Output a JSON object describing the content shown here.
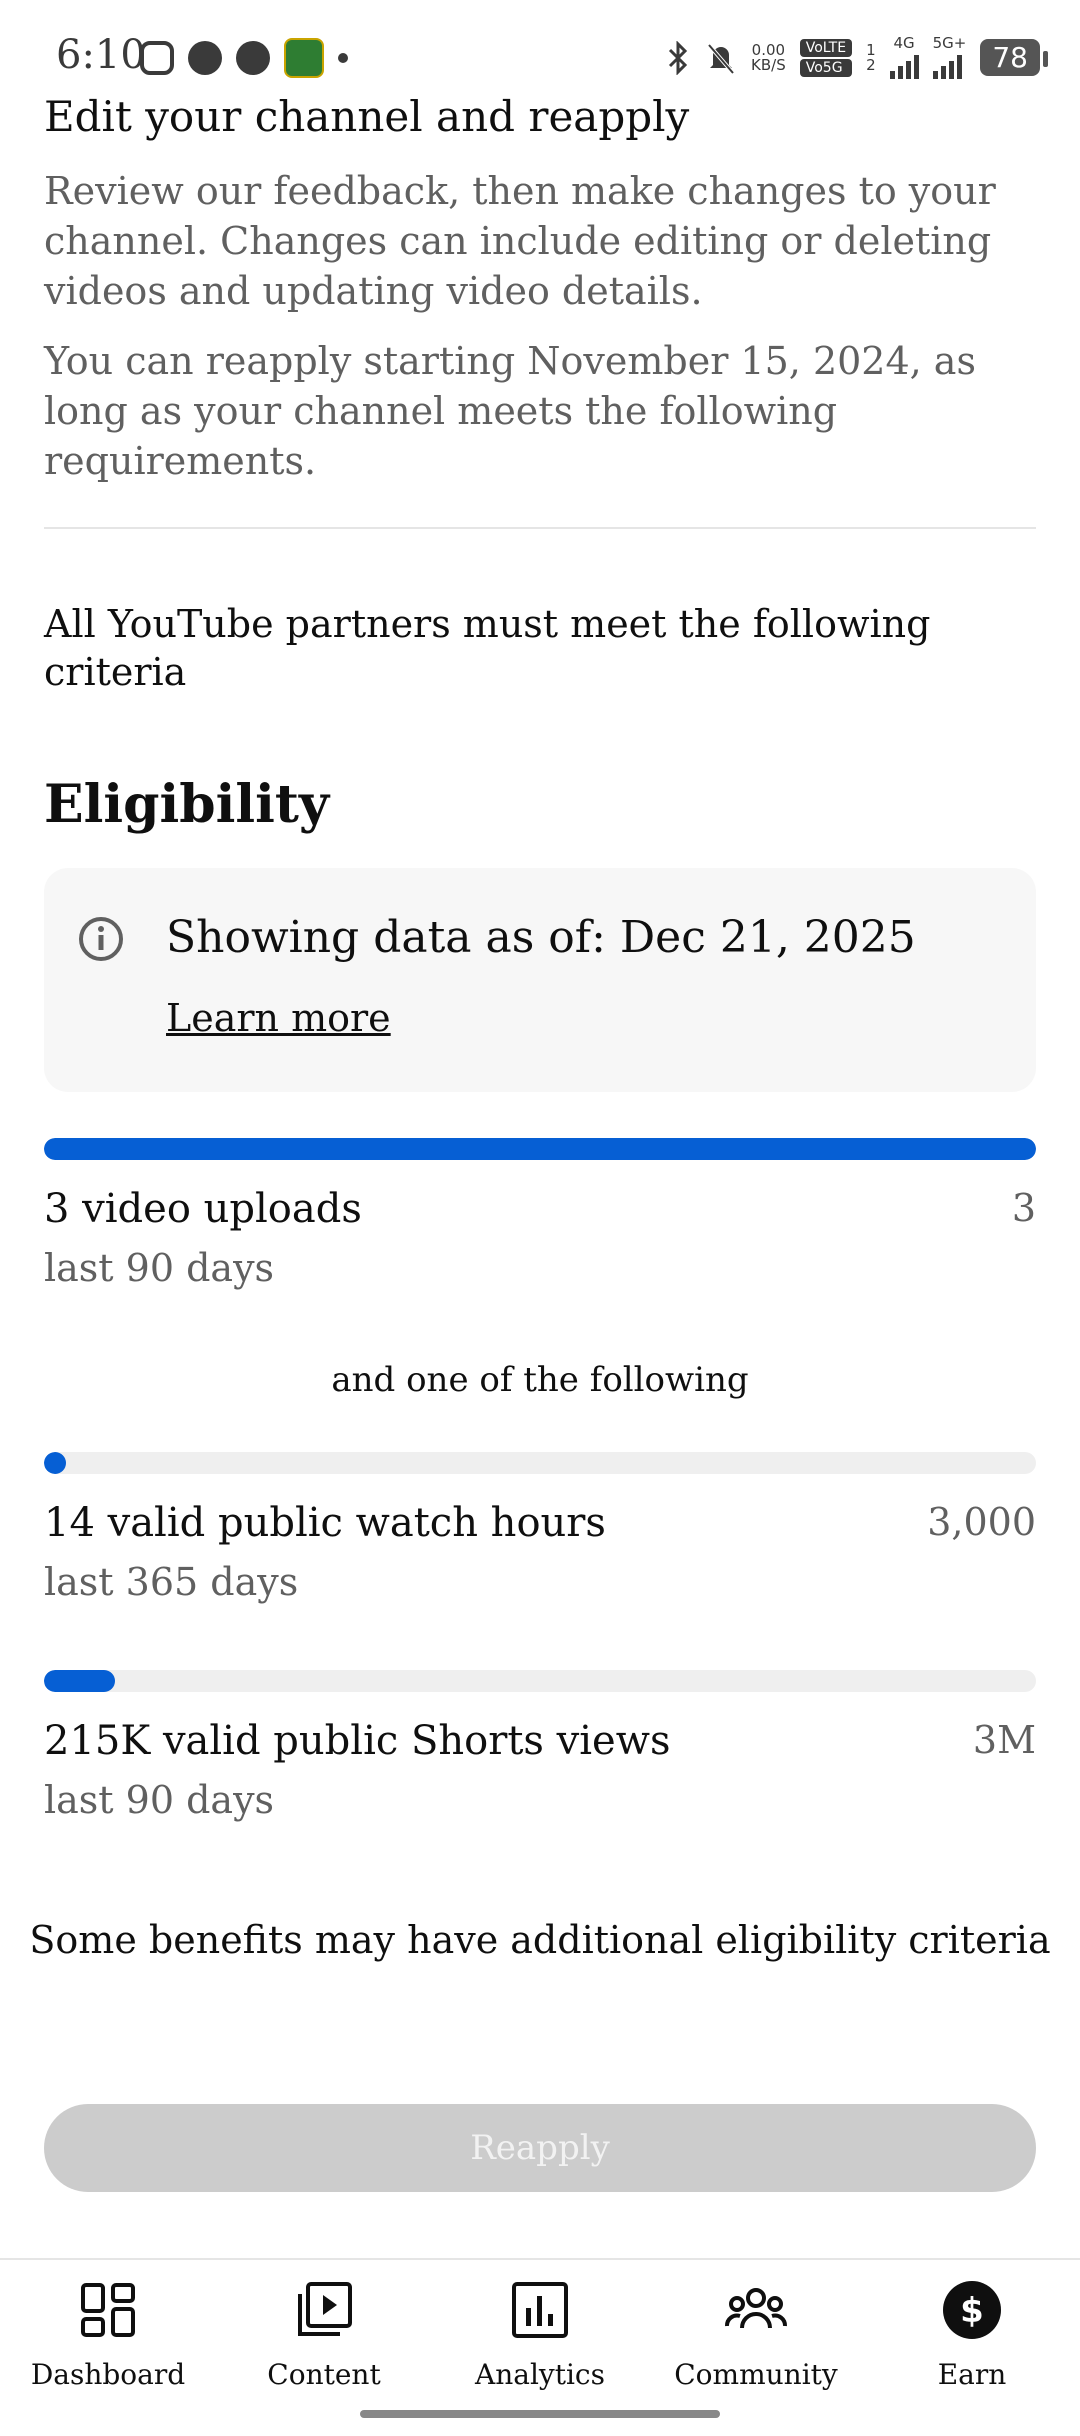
{
  "status_bar": {
    "time": "6:10",
    "net_speed_top": "0.00",
    "net_speed_bottom": "KB/S",
    "volte": "VoLTE",
    "vo5g": "Vo5G",
    "sim1": "1",
    "sim2": "2",
    "net1": "4G",
    "net2": "5G+",
    "battery": "78"
  },
  "reapply_info": {
    "heading": "Edit your channel and reapply",
    "paragraph1": "Review our feedback, then make changes to your channel. Changes can include editing or deleting videos and updating video details.",
    "paragraph2": "You can reapply starting November 15, 2024, as long as your channel meets the following requirements."
  },
  "criteria_text": "All YouTube partners must meet the following criteria",
  "eligibility": {
    "title": "Eligibility",
    "data_as_of": "Showing data as of: Dec 21, 2025",
    "learn_more": "Learn more",
    "requirements": [
      {
        "title": "3 video uploads",
        "target": "3",
        "period": "last 90 days",
        "progress": 1.0
      },
      {
        "title": "14 valid public watch hours",
        "target": "3,000",
        "period": "last 365 days",
        "progress": 0.005
      },
      {
        "title": "215K valid public Shorts views",
        "target": "3M",
        "period": "last 90 days",
        "progress": 0.072
      }
    ],
    "one_of_following": "and one of the following",
    "benefits_note": "Some benefits may have additional eligibility criteria"
  },
  "reapply_button": "Reapply",
  "bottom_nav": [
    {
      "label": "Dashboard",
      "icon": "dashboard-icon"
    },
    {
      "label": "Content",
      "icon": "content-icon"
    },
    {
      "label": "Analytics",
      "icon": "analytics-icon"
    },
    {
      "label": "Community",
      "icon": "community-icon"
    },
    {
      "label": "Earn",
      "icon": "earn-icon"
    }
  ],
  "colors": {
    "progress_fill": "#065fd4",
    "progress_track": "#efefef",
    "button_disabled": "#cccccc"
  }
}
